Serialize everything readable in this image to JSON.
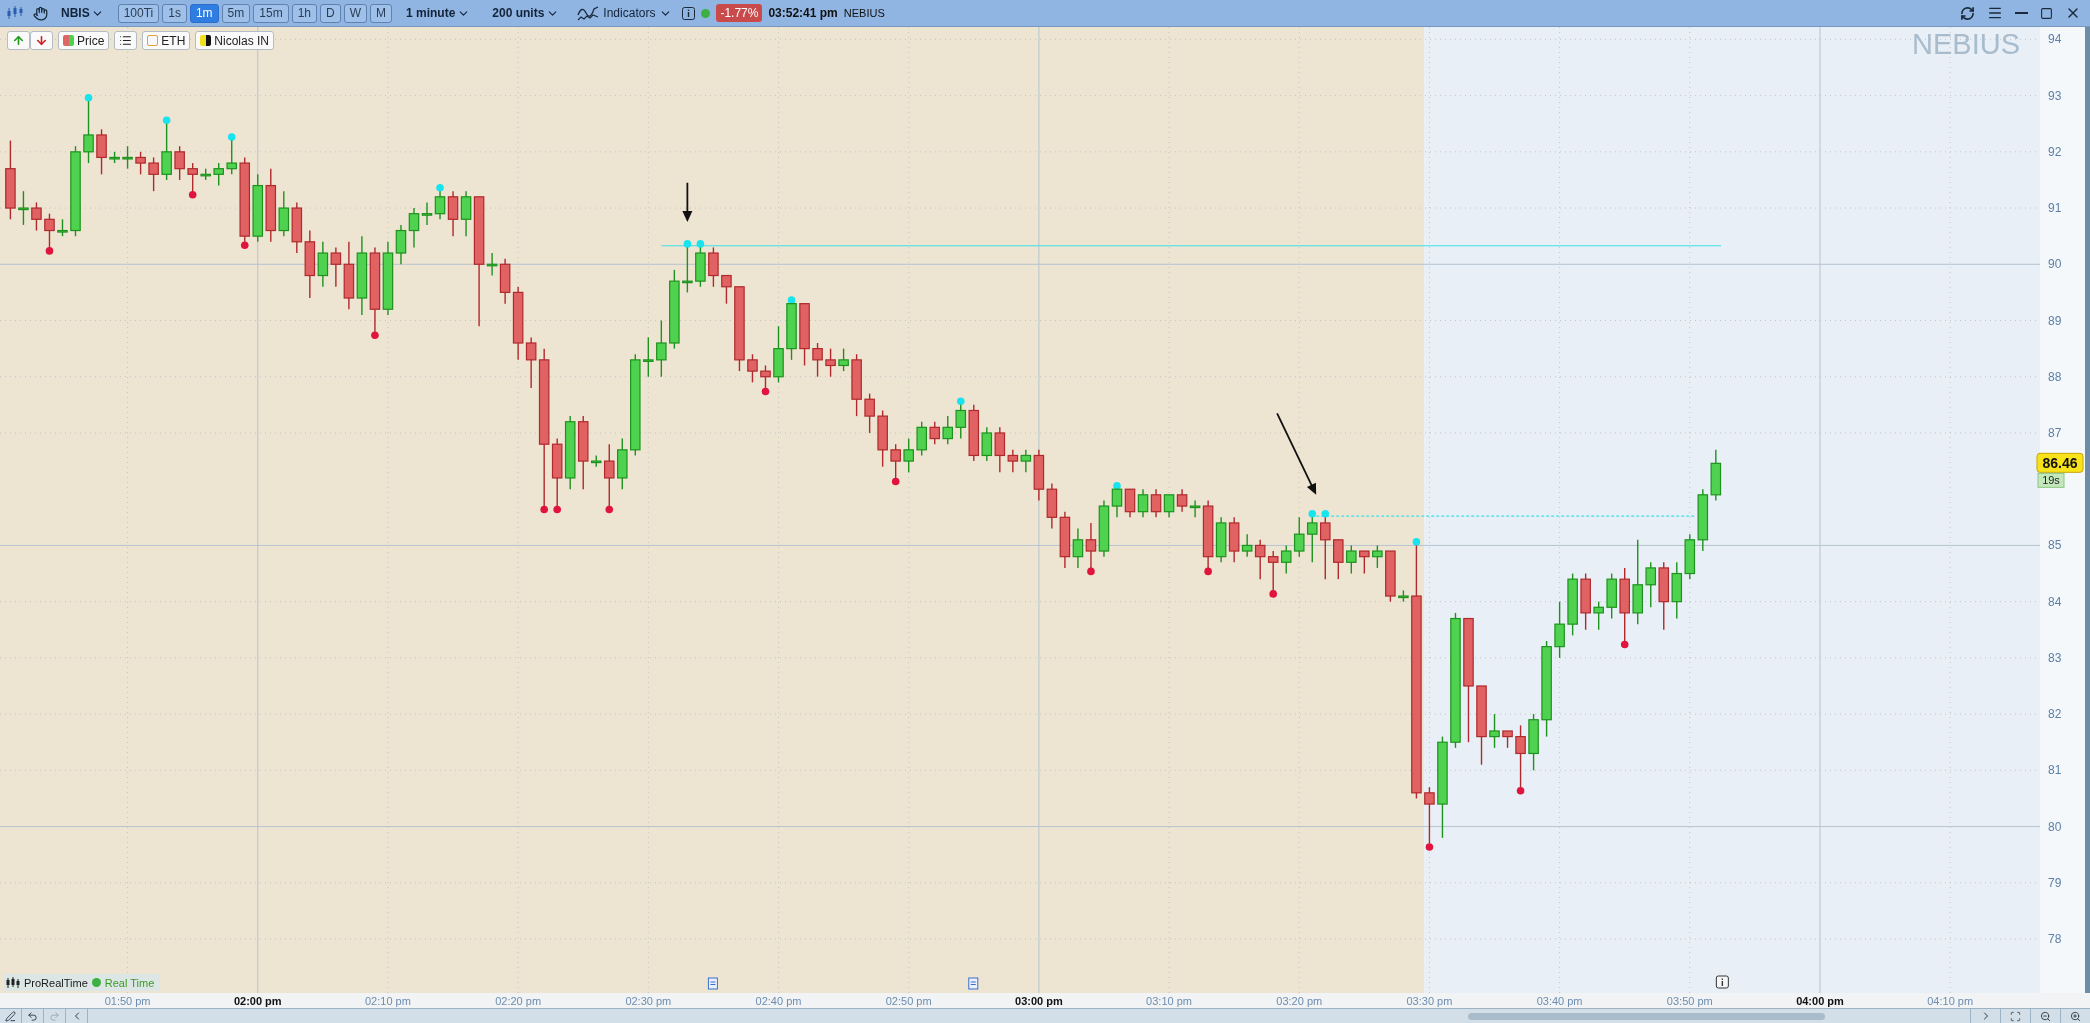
{
  "toolbar": {
    "symbol": "NBIS",
    "timeframes": [
      {
        "label": "100Ti",
        "selected": false
      },
      {
        "label": "1s",
        "selected": false
      },
      {
        "label": "1m",
        "selected": true
      },
      {
        "label": "5m",
        "selected": false
      },
      {
        "label": "15m",
        "selected": false
      },
      {
        "label": "1h",
        "selected": false
      },
      {
        "label": "D",
        "selected": false
      },
      {
        "label": "W",
        "selected": false
      },
      {
        "label": "M",
        "selected": false
      }
    ],
    "interval": "1 minute",
    "units": "200 units",
    "indicators": "Indicators",
    "market_open": true,
    "change": "-1.77%",
    "time": "03:52:41 pm",
    "name": "NEBIUS"
  },
  "legend": [
    {
      "kind": "price",
      "label": "Price"
    },
    {
      "kind": "list"
    },
    {
      "kind": "outline",
      "label": "ETH",
      "color": "#e0a040"
    },
    {
      "kind": "indicator",
      "label": "Nicolas IN",
      "color": "#f2e01c"
    }
  ],
  "chart": {
    "watermark": "NEBIUS",
    "price_label": "86.46",
    "countdown": "19s",
    "platform": "ProRealTime",
    "feed": "Real Time",
    "connected": true,
    "chart_data": {
      "type": "candlestick",
      "grid": true,
      "xlim": [
        820.2,
        976.9
      ],
      "ylim": [
        77.04,
        94.22
      ],
      "xticks": [
        {
          "value": 830,
          "label": "01:50 pm"
        },
        {
          "value": 840,
          "label": "02:00 pm"
        },
        {
          "value": 850,
          "label": "02:10 pm"
        },
        {
          "value": 860,
          "label": "02:20 pm"
        },
        {
          "value": 870,
          "label": "02:30 pm"
        },
        {
          "value": 880,
          "label": "02:40 pm"
        },
        {
          "value": 890,
          "label": "02:50 pm"
        },
        {
          "value": 900,
          "label": "03:00 pm"
        },
        {
          "value": 910,
          "label": "03:10 pm"
        },
        {
          "value": 920,
          "label": "03:20 pm"
        },
        {
          "value": 930,
          "label": "03:30 pm"
        },
        {
          "value": 940,
          "label": "03:40 pm"
        },
        {
          "value": 950,
          "label": "03:50 pm"
        },
        {
          "value": 960,
          "label": "04:00 pm"
        },
        {
          "value": 970,
          "label": "04:10 pm"
        }
      ],
      "yticks": [
        {
          "value": 78,
          "label": "78"
        },
        {
          "value": 79,
          "label": "79"
        },
        {
          "value": 80,
          "label": "80"
        },
        {
          "value": 81,
          "label": "81"
        },
        {
          "value": 82,
          "label": "82"
        },
        {
          "value": 83,
          "label": "83"
        },
        {
          "value": 84,
          "label": "84"
        },
        {
          "value": 85,
          "label": "85"
        },
        {
          "value": 87,
          "label": "87"
        },
        {
          "value": 88,
          "label": "88"
        },
        {
          "value": 89,
          "label": "89"
        },
        {
          "value": 90,
          "label": "90"
        },
        {
          "value": 91,
          "label": "91"
        },
        {
          "value": 92,
          "label": "92"
        },
        {
          "value": 93,
          "label": "93"
        },
        {
          "value": 94,
          "label": "94"
        }
      ],
      "x": [
        821,
        822,
        823,
        824,
        825,
        826,
        827,
        828,
        829,
        830,
        831,
        832,
        833,
        834,
        835,
        836,
        837,
        838,
        839,
        840,
        841,
        842,
        843,
        844,
        845,
        846,
        847,
        848,
        849,
        850,
        851,
        852,
        853,
        854,
        855,
        856,
        857,
        858,
        859,
        860,
        861,
        862,
        863,
        864,
        865,
        866,
        867,
        868,
        869,
        870,
        871,
        872,
        873,
        874,
        875,
        876,
        877,
        878,
        879,
        880,
        881,
        882,
        883,
        884,
        885,
        886,
        887,
        888,
        889,
        890,
        891,
        892,
        893,
        894,
        895,
        896,
        897,
        898,
        899,
        900,
        901,
        902,
        903,
        904,
        905,
        906,
        907,
        908,
        909,
        910,
        911,
        912,
        913,
        914,
        915,
        916,
        917,
        918,
        919,
        920,
        921,
        922,
        923,
        924,
        925,
        926,
        927,
        928,
        929,
        930,
        931,
        932,
        933,
        934,
        935,
        936,
        937,
        938,
        939,
        940,
        941,
        942,
        943,
        944,
        945,
        946,
        947,
        948,
        949,
        950,
        951,
        952
      ],
      "ohlc": [
        [
          91.7,
          92.2,
          90.8,
          91.0
        ],
        [
          91.0,
          91.3,
          90.7,
          91.0
        ],
        [
          91.0,
          91.1,
          90.6,
          90.8
        ],
        [
          90.8,
          90.9,
          90.3,
          90.6
        ],
        [
          90.6,
          90.8,
          90.5,
          90.6
        ],
        [
          90.6,
          92.1,
          90.5,
          92.0
        ],
        [
          92.0,
          92.9,
          91.8,
          92.3
        ],
        [
          92.3,
          92.4,
          91.6,
          91.9
        ],
        [
          91.9,
          92.0,
          91.8,
          91.9
        ],
        [
          91.9,
          92.1,
          91.7,
          91.9
        ],
        [
          91.9,
          92.0,
          91.6,
          91.8
        ],
        [
          91.8,
          91.9,
          91.3,
          91.6
        ],
        [
          91.6,
          92.5,
          91.5,
          92.0
        ],
        [
          92.0,
          92.1,
          91.5,
          91.7
        ],
        [
          91.7,
          91.8,
          91.3,
          91.6
        ],
        [
          91.6,
          91.7,
          91.5,
          91.6
        ],
        [
          91.6,
          91.8,
          91.4,
          91.7
        ],
        [
          91.7,
          92.2,
          91.6,
          91.8
        ],
        [
          91.8,
          91.9,
          90.4,
          90.5
        ],
        [
          90.5,
          91.6,
          90.4,
          91.4
        ],
        [
          91.4,
          91.7,
          90.4,
          90.6
        ],
        [
          90.6,
          91.3,
          90.5,
          91.0
        ],
        [
          91.0,
          91.1,
          90.2,
          90.4
        ],
        [
          90.4,
          90.6,
          89.4,
          89.8
        ],
        [
          89.8,
          90.4,
          89.6,
          90.2
        ],
        [
          90.2,
          90.3,
          89.6,
          90.0
        ],
        [
          90.0,
          90.4,
          89.2,
          89.4
        ],
        [
          89.4,
          90.5,
          89.1,
          90.2
        ],
        [
          90.2,
          90.3,
          88.8,
          89.2
        ],
        [
          89.2,
          90.4,
          89.1,
          90.2
        ],
        [
          90.2,
          90.7,
          90.0,
          90.6
        ],
        [
          90.6,
          91.0,
          90.3,
          90.9
        ],
        [
          90.9,
          91.1,
          90.7,
          90.9
        ],
        [
          90.9,
          91.3,
          90.8,
          91.2
        ],
        [
          91.2,
          91.3,
          90.5,
          90.8
        ],
        [
          90.8,
          91.3,
          90.5,
          91.2
        ],
        [
          91.2,
          91.2,
          88.9,
          90.0
        ],
        [
          90.0,
          90.2,
          89.8,
          90.0
        ],
        [
          90.0,
          90.1,
          89.3,
          89.5
        ],
        [
          89.5,
          89.6,
          88.3,
          88.6
        ],
        [
          88.6,
          88.7,
          87.8,
          88.3
        ],
        [
          88.3,
          88.5,
          85.7,
          86.8
        ],
        [
          86.8,
          86.9,
          85.7,
          86.2
        ],
        [
          86.2,
          87.3,
          86.0,
          87.2
        ],
        [
          87.2,
          87.3,
          86.0,
          86.5
        ],
        [
          86.5,
          86.6,
          86.4,
          86.5
        ],
        [
          86.5,
          86.8,
          85.7,
          86.2
        ],
        [
          86.2,
          86.9,
          86.0,
          86.7
        ],
        [
          86.7,
          88.4,
          86.6,
          88.3
        ],
        [
          88.3,
          88.7,
          88.0,
          88.3
        ],
        [
          88.3,
          89.0,
          88.0,
          88.6
        ],
        [
          88.6,
          89.9,
          88.5,
          89.7
        ],
        [
          89.7,
          90.3,
          89.5,
          89.7
        ],
        [
          89.7,
          90.3,
          89.6,
          90.2
        ],
        [
          90.2,
          90.3,
          89.6,
          89.8
        ],
        [
          89.8,
          89.8,
          89.3,
          89.6
        ],
        [
          89.6,
          89.6,
          88.1,
          88.3
        ],
        [
          88.3,
          88.4,
          87.9,
          88.1
        ],
        [
          88.1,
          88.2,
          87.8,
          88.0
        ],
        [
          88.0,
          88.9,
          87.9,
          88.5
        ],
        [
          88.5,
          89.3,
          88.3,
          89.3
        ],
        [
          89.3,
          89.3,
          88.2,
          88.5
        ],
        [
          88.5,
          88.6,
          88.0,
          88.3
        ],
        [
          88.3,
          88.5,
          88.0,
          88.2
        ],
        [
          88.2,
          88.5,
          88.1,
          88.3
        ],
        [
          88.3,
          88.4,
          87.3,
          87.6
        ],
        [
          87.6,
          87.7,
          87.0,
          87.3
        ],
        [
          87.3,
          87.4,
          86.4,
          86.7
        ],
        [
          86.7,
          86.8,
          86.2,
          86.5
        ],
        [
          86.5,
          86.9,
          86.3,
          86.7
        ],
        [
          86.7,
          87.2,
          86.6,
          87.1
        ],
        [
          87.1,
          87.2,
          86.8,
          86.9
        ],
        [
          86.9,
          87.3,
          86.8,
          87.1
        ],
        [
          87.1,
          87.5,
          86.9,
          87.4
        ],
        [
          87.4,
          87.5,
          86.5,
          86.6
        ],
        [
          86.6,
          87.1,
          86.5,
          87.0
        ],
        [
          87.0,
          87.1,
          86.3,
          86.6
        ],
        [
          86.6,
          86.7,
          86.3,
          86.5
        ],
        [
          86.5,
          86.7,
          86.3,
          86.6
        ],
        [
          86.6,
          86.7,
          85.8,
          86.0
        ],
        [
          86.0,
          86.1,
          85.3,
          85.5
        ],
        [
          85.5,
          85.6,
          84.6,
          84.8
        ],
        [
          84.8,
          85.3,
          84.6,
          85.1
        ],
        [
          85.1,
          85.4,
          84.6,
          84.9
        ],
        [
          84.9,
          85.8,
          84.8,
          85.7
        ],
        [
          85.7,
          86.0,
          85.5,
          86.0
        ],
        [
          86.0,
          86.0,
          85.5,
          85.6
        ],
        [
          85.6,
          86.0,
          85.5,
          85.9
        ],
        [
          85.9,
          86.0,
          85.5,
          85.6
        ],
        [
          85.6,
          85.9,
          85.5,
          85.9
        ],
        [
          85.9,
          86.0,
          85.6,
          85.7
        ],
        [
          85.7,
          85.8,
          85.5,
          85.7
        ],
        [
          85.7,
          85.8,
          84.6,
          84.8
        ],
        [
          84.8,
          85.5,
          84.7,
          85.4
        ],
        [
          85.4,
          85.5,
          84.7,
          84.9
        ],
        [
          84.9,
          85.2,
          84.8,
          85.0
        ],
        [
          85.0,
          85.1,
          84.4,
          84.8
        ],
        [
          84.8,
          84.9,
          84.2,
          84.7
        ],
        [
          84.7,
          85.0,
          84.5,
          84.9
        ],
        [
          84.9,
          85.5,
          84.8,
          85.2
        ],
        [
          85.2,
          85.5,
          84.7,
          85.4
        ],
        [
          85.4,
          85.5,
          84.4,
          85.1
        ],
        [
          85.1,
          85.1,
          84.4,
          84.7
        ],
        [
          84.7,
          85.0,
          84.5,
          84.9
        ],
        [
          84.9,
          84.9,
          84.5,
          84.8
        ],
        [
          84.8,
          85.0,
          84.6,
          84.9
        ],
        [
          84.9,
          84.9,
          84.0,
          84.1
        ],
        [
          84.1,
          84.2,
          84.0,
          84.1
        ],
        [
          84.1,
          85.0,
          80.5,
          80.6
        ],
        [
          80.6,
          80.7,
          79.7,
          80.4
        ],
        [
          80.4,
          81.6,
          79.8,
          81.5
        ],
        [
          81.5,
          83.8,
          81.4,
          83.7
        ],
        [
          83.7,
          83.7,
          81.5,
          82.5
        ],
        [
          82.5,
          82.5,
          81.1,
          81.6
        ],
        [
          81.6,
          82.0,
          81.4,
          81.7
        ],
        [
          81.7,
          81.7,
          81.4,
          81.6
        ],
        [
          81.6,
          81.8,
          80.7,
          81.3
        ],
        [
          81.3,
          82.0,
          81.0,
          81.9
        ],
        [
          81.9,
          83.3,
          81.6,
          83.2
        ],
        [
          83.2,
          84.0,
          83.0,
          83.6
        ],
        [
          83.6,
          84.5,
          83.4,
          84.4
        ],
        [
          84.4,
          84.5,
          83.5,
          83.8
        ],
        [
          83.8,
          84.0,
          83.5,
          83.9
        ],
        [
          83.9,
          84.5,
          83.7,
          84.4
        ],
        [
          84.4,
          84.6,
          83.3,
          83.8
        ],
        [
          83.8,
          85.1,
          83.6,
          84.3
        ],
        [
          84.3,
          84.7,
          83.9,
          84.6
        ],
        [
          84.6,
          84.7,
          83.5,
          84.0
        ],
        [
          84.0,
          84.7,
          83.7,
          84.5
        ],
        [
          84.5,
          85.2,
          84.4,
          85.1
        ],
        [
          85.1,
          86.0,
          84.9,
          85.9
        ],
        [
          85.9,
          86.7,
          85.8,
          86.46
        ]
      ],
      "ref_lines": [
        {
          "axis": "y",
          "value": 90.33
        },
        {
          "axis": "y",
          "value": 85.52
        }
      ],
      "bands": [
        {
          "axis": "x",
          "from": 820.2,
          "to": 929.6,
          "color": "#eee4d2"
        },
        {
          "axis": "x",
          "from": 929.6,
          "to": 976.9,
          "color": "#e8eff6"
        }
      ]
    }
  },
  "bottom_bar": {
    "tools": [
      {
        "kind": "draw",
        "disabled": false
      },
      {
        "kind": "undo",
        "disabled": false
      },
      {
        "kind": "redo",
        "disabled": true
      },
      {
        "kind": "back",
        "disabled": false
      }
    ]
  }
}
